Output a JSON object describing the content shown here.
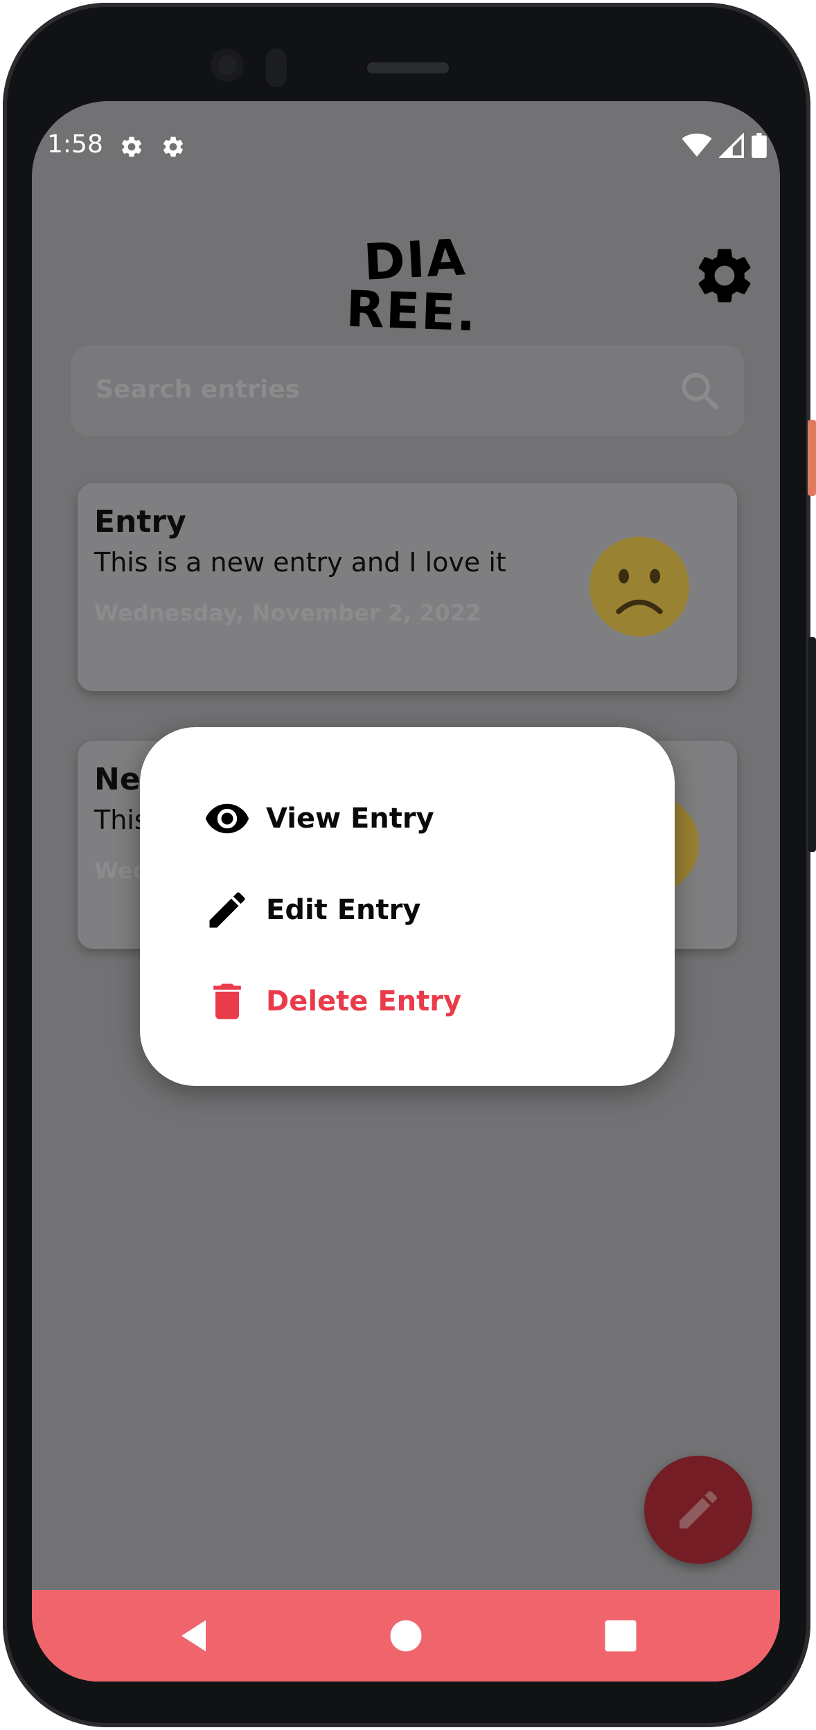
{
  "status_bar": {
    "time": "1:58",
    "icons": [
      "gear-icon",
      "gear-icon",
      "wifi-icon",
      "signal-icon",
      "battery-icon"
    ]
  },
  "header": {
    "logo_text": [
      "DIA",
      "REE."
    ],
    "settings_icon": "gear-icon"
  },
  "search": {
    "placeholder": "Search entries",
    "icon": "search-icon"
  },
  "entries": [
    {
      "title": "Entry",
      "text": "This is a new entry and I love it",
      "date": "Wednesday, November 2, 2022",
      "mood_icon": "sad-face-icon"
    },
    {
      "title": "New",
      "text": "This",
      "date": "Wed",
      "mood_icon": "sad-face-icon"
    }
  ],
  "context_menu": {
    "items": [
      {
        "label": "View Entry",
        "icon": "eye-icon"
      },
      {
        "label": "Edit Entry",
        "icon": "pencil-icon"
      },
      {
        "label": "Delete Entry",
        "icon": "trash-icon"
      }
    ]
  },
  "fab": {
    "icon": "pencil-icon"
  },
  "nav_bar": {
    "icons": [
      "back-icon",
      "home-icon",
      "recents-icon"
    ]
  },
  "colors": {
    "accent": "#f0646c",
    "danger": "#ea3b4a",
    "fab": "#751d24",
    "scrim": "#727274",
    "emoji": "#9a8233"
  }
}
